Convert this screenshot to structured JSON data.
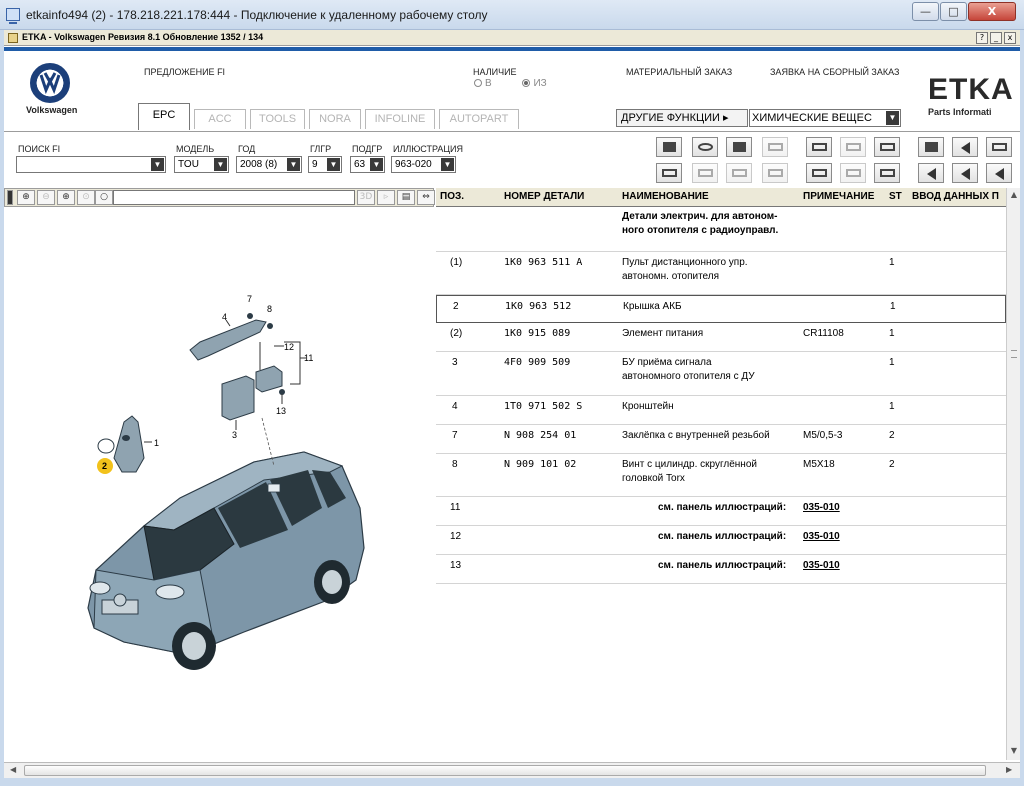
{
  "window": {
    "title": "etkainfo494 (2) - 178.218.221.178:444 - Подключение к удаленному рабочему столу",
    "min_glyph": "—",
    "max_glyph": "□",
    "close_glyph": "X"
  },
  "app": {
    "title": "ETKA - Volkswagen Ревизия 8.1 Обновление 1352 / 134",
    "help_glyph": "?",
    "min_glyph": "_",
    "close_glyph": "x"
  },
  "header": {
    "brand": "Volkswagen",
    "offer_label": "ПРЕДЛОЖЕНИЕ FI",
    "availability_label": "НАЛИЧИЕ",
    "radio_in": "В",
    "radio_from": "ИЗ",
    "material_order_label": "МАТЕРИАЛЬНЫЙ ЗАКАЗ",
    "assembly_order_label": "ЗАЯВКА НА СБОРНЫЙ ЗАКАЗ",
    "etka_logo": "ETKA",
    "etka_sub": "Parts Informati",
    "other_functions_label": "ДРУГИЕ ФУНКЦИИ ▸",
    "other_functions_value": "ХИМИЧЕСКИЕ ВЕЩЕС"
  },
  "tabs": [
    {
      "label": "EPC",
      "active": true
    },
    {
      "label": "ACC",
      "active": false
    },
    {
      "label": "TOOLS",
      "active": false
    },
    {
      "label": "NORA",
      "active": false
    },
    {
      "label": "INFOLINE",
      "active": false
    },
    {
      "label": "AUTOPART",
      "active": false
    }
  ],
  "filters": {
    "search_label": "ПОИСК FI",
    "search_value": "",
    "model_label": "МОДЕЛЬ",
    "model_value": "TOU",
    "year_label": "ГОД",
    "year_value": "2008 (8)",
    "main_group_label": "ГЛГР",
    "main_group_value": "9",
    "sub_group_label": "ПОДГР",
    "sub_group_value": "63",
    "illustration_label": "ИЛЛЮСТРАЦИЯ",
    "illustration_value": "963-020"
  },
  "ill_toolbar": {
    "three_d": "3D"
  },
  "columns": {
    "pos": "ПОЗ.",
    "part_no": "НОМЕР ДЕТАЛИ",
    "name": "НАИМЕНОВАНИЕ",
    "note": "ПРИМЕЧАНИЕ",
    "st": "ST",
    "input": "ВВОД ДАННЫХ П"
  },
  "section_header": {
    "line1": "Детали электрич. для автоном-",
    "line2": "ного отопителя с радиоуправл."
  },
  "rows": [
    {
      "pos": "(1)",
      "part": "1K0  963  511  A",
      "name1": "Пульт дистанционного упр.",
      "name2": "автономн. отопителя",
      "note": "",
      "st": "1"
    },
    {
      "pos": "2",
      "part": "1K0  963  512",
      "name1": "Крышка АКБ",
      "name2": "",
      "note": "",
      "st": "1"
    },
    {
      "pos": "(2)",
      "part": "1K0  915  089",
      "name1": "Элемент питания",
      "name2": "",
      "note": "CR11108",
      "st": "1"
    },
    {
      "pos": "3",
      "part": "4F0  909  509",
      "name1": "БУ приёма сигнала",
      "name2": "автономного отопителя с ДУ",
      "note": "",
      "st": "1"
    },
    {
      "pos": "4",
      "part": "1T0  971  502  S",
      "name1": "Кронштейн",
      "name2": "",
      "note": "",
      "st": "1"
    },
    {
      "pos": "7",
      "part": "N    908  254  01",
      "name1": "Заклёпка с внутренней резьбой",
      "name2": "",
      "note": "M5/0,5-3",
      "st": "2"
    },
    {
      "pos": "8",
      "part": "N    909  101  02",
      "name1": "Винт с цилиндр. скруглённой",
      "name2": "головкой Torx",
      "note": "M5X18",
      "st": "2"
    }
  ],
  "ref_rows": [
    {
      "pos": "11",
      "text": "см. панель иллюстраций:",
      "link": "035-010"
    },
    {
      "pos": "12",
      "text": "см. панель иллюстраций:",
      "link": "035-010"
    },
    {
      "pos": "13",
      "text": "см. панель иллюстраций:",
      "link": "035-010"
    }
  ],
  "callouts": {
    "c1": "1",
    "c2": "2",
    "c3": "3",
    "c4": "4",
    "c7": "7",
    "c8": "8",
    "c11": "11",
    "c12": "12",
    "c13": "13"
  },
  "colors": {
    "accent_blue": "#1f5ca8",
    "callout_yellow": "#f2c21b",
    "car_body": "#7d96a8"
  }
}
